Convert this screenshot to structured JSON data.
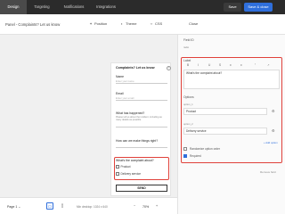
{
  "topbar": {
    "tabs": [
      {
        "label": "Design"
      },
      {
        "label": "Targeting"
      },
      {
        "label": "Notifications"
      },
      {
        "label": "Integrations"
      }
    ],
    "save_label": "Save",
    "save_close_label": "Save & close"
  },
  "subbar": {
    "title": "Panel - Complaints? Let us know",
    "position_label": "Position",
    "theme_label": "Theme",
    "css_label": "CSS",
    "close_label": "Close"
  },
  "form": {
    "title": "Complaints? Let us know",
    "help_glyph": "?",
    "name_label": "Name",
    "name_placeholder": "Enter your name",
    "email_label": "Email",
    "email_placeholder": "Enter your email",
    "what_happened_label": "What has happened?",
    "what_happened_help": "Please tell us about the incident, including as many details as possible",
    "how_label": "How can we make things right?",
    "complaint_label": "What's the complaint about?",
    "options": [
      "Product",
      "Delivery service"
    ],
    "send_label": "SEND"
  },
  "panel": {
    "field_id_label": "Field ID",
    "field_id_value": "radio",
    "label_title": "Label",
    "format_buttons": [
      "B",
      "I",
      "U",
      "S",
      "≡",
      "≡",
      "”",
      "↗"
    ],
    "label_value": "What's the complaint about?",
    "options_title": "Options",
    "option_1_label": "option_1",
    "option_1_value": "Product",
    "option_2_label": "option_2",
    "option_2_value": "Delivery service",
    "add_option_label": "+ Add option",
    "randomize_label": "Randomize option order",
    "required_label": "Required",
    "remove_field_label": "Remove field"
  },
  "bottombar": {
    "page_label": "Page 1",
    "resolution_label": "Min desktop: 1024 x 640",
    "zoom_label": "70%"
  },
  "colors": {
    "accent": "#2f6fdc",
    "highlight": "#e0413a",
    "topbar_bg": "#2b2b2b"
  },
  "icons": {
    "position": "position-icon",
    "theme": "theme-icon",
    "css": "css-icon",
    "settings": "gear-icon",
    "desktop": "desktop-icon",
    "mobile": "mobile-icon"
  }
}
